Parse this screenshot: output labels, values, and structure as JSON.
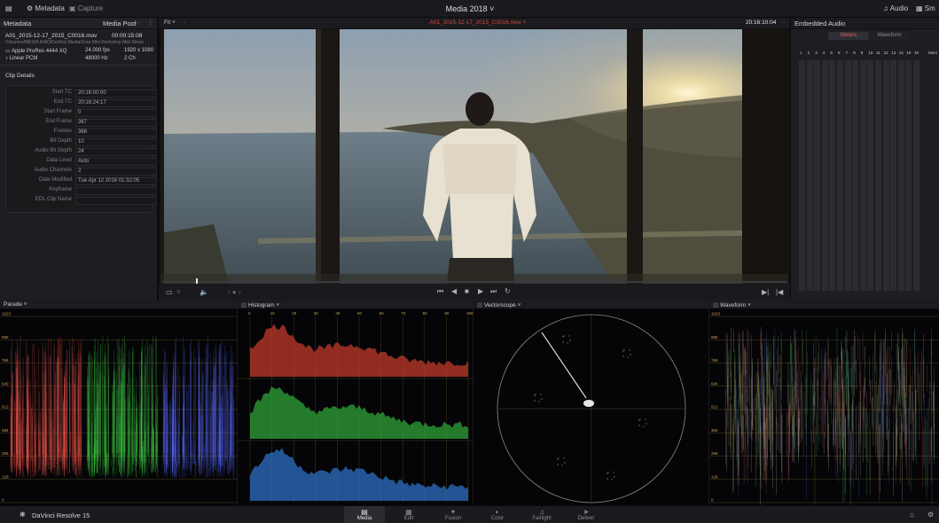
{
  "topbar": {
    "metadata_label": "Metadata",
    "capture_label": "Capture",
    "project_title": "Media 2018",
    "audio_label": "Audio",
    "right_label": "Sm"
  },
  "metadata_panel": {
    "title": "Metadata",
    "media_pool_label": "Media Pool",
    "clip_name": "A01_2015-12-17_2015_C0016.mov",
    "clip_duration": "00:00:15:08",
    "clip_path": "/Volumes/MEDIA RAID/DaVinci Media/Ursa Mini Workshop Mini Movie",
    "codec": "Apple ProRes 4444 XQ",
    "fps": "24.000 fps",
    "resolution": "1920 x 1080",
    "audio_codec": "Linear PCM",
    "audio_rate": "48000 Hz",
    "audio_channels": "2 Ch",
    "section_title": "Clip Details",
    "rows": [
      {
        "label": "Start TC",
        "value": "20:16:00:00"
      },
      {
        "label": "End TC",
        "value": "20:16:24:17"
      },
      {
        "label": "Start Frame",
        "value": "0"
      },
      {
        "label": "End Frame",
        "value": "367"
      },
      {
        "label": "Frames",
        "value": "368"
      },
      {
        "label": "Bit Depth",
        "value": "10"
      },
      {
        "label": "Audio Bit Depth",
        "value": "24"
      },
      {
        "label": "Data Level",
        "value": "Auto"
      },
      {
        "label": "Audio Channels",
        "value": "2"
      },
      {
        "label": "Date Modified",
        "value": "Tue Apr 12 2016 01:32:05"
      },
      {
        "label": "Keyframe",
        "value": ""
      },
      {
        "label": "EDL Clip Name",
        "value": ""
      }
    ]
  },
  "viewer": {
    "fit_label": "Fit",
    "clip_title": "A01_2015-12-17_2015_C0016.mov",
    "timecode": "20:16:10:04"
  },
  "audio_panel": {
    "title": "Embedded Audio",
    "tab_meters": "Meters",
    "tab_waveform": "Waveform",
    "channels": [
      "1",
      "2",
      "3",
      "4",
      "5",
      "6",
      "7",
      "8",
      "9",
      "10",
      "11",
      "12",
      "13",
      "14",
      "15",
      "16"
    ],
    "mon_label": "Moni"
  },
  "scopes": {
    "parade_title": "Parade",
    "histogram_title": "Histogram",
    "vectorscope_title": "Vectorscope",
    "waveform_title": "Waveform",
    "grid_labels": [
      "1023",
      "896",
      "768",
      "640",
      "512",
      "384",
      "256",
      "128",
      "0"
    ],
    "histogram_ticks": [
      "0",
      "10",
      "20",
      "30",
      "40",
      "50",
      "60",
      "70",
      "80",
      "90",
      "100"
    ]
  },
  "bottom": {
    "app_name": "DaVinci Resolve 15",
    "pages": [
      "Media",
      "Edit",
      "Fusion",
      "Color",
      "Fairlight",
      "Deliver"
    ],
    "active_page": "Media"
  },
  "colors": {
    "accent_red": "#e0453a",
    "timecode_orange": "#e07a3a",
    "scope_label_gold": "#c9a14a",
    "panel_bg": "#1e1e22"
  }
}
